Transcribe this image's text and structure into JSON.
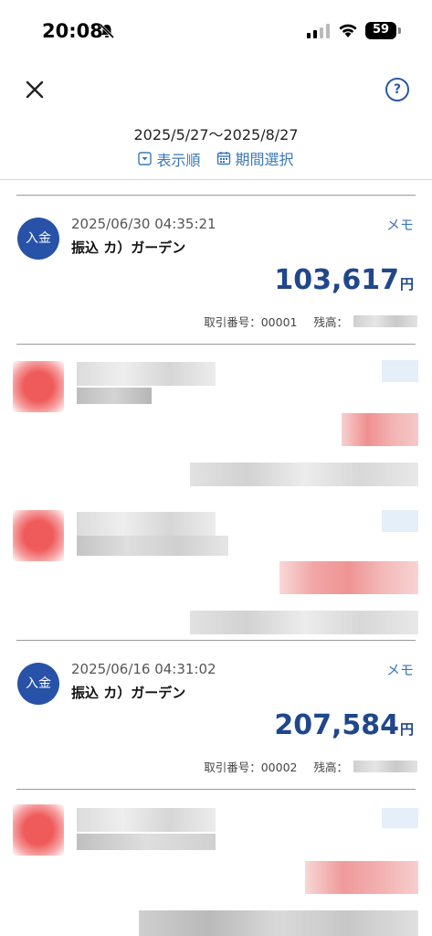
{
  "status_bar": {
    "time": "20:08",
    "battery": "59"
  },
  "header": {
    "period": "2025/5/27〜2025/8/27",
    "sort_label": "表示順",
    "period_select_label": "期間選択"
  },
  "transactions": [
    {
      "badge": "入金",
      "datetime": "2025/06/30 04:35:21",
      "description": "振込 カ）ガーデン",
      "memo": "メモ",
      "amount": "103,617",
      "currency": "円",
      "txn_no": "取引番号：00001",
      "balance_label": "残高："
    },
    {
      "badge": "入金",
      "datetime": "2025/06/16 04:31:02",
      "description": "振込 カ）ガーデン",
      "memo": "メモ",
      "amount": "207,584",
      "currency": "円",
      "txn_no": "取引番号：00002",
      "balance_label": "残高："
    }
  ],
  "colors": {
    "accent": "#3a78b8",
    "amount": "#20478a",
    "badge": "#2752a8"
  }
}
